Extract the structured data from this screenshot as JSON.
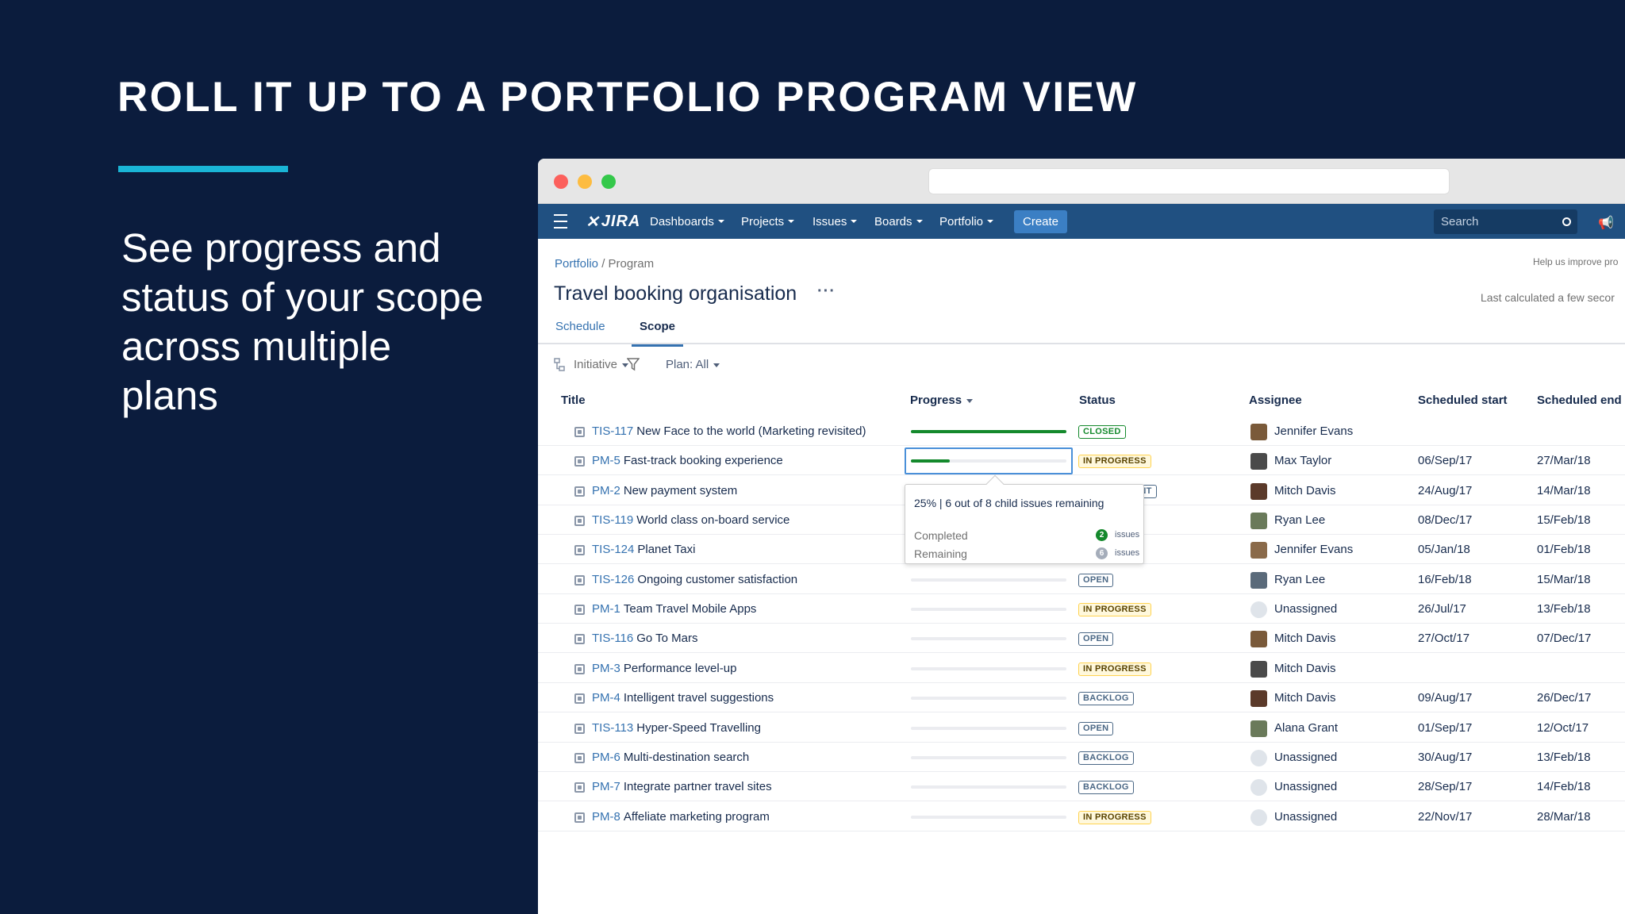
{
  "slide": {
    "title": "ROLL IT UP TO A PORTFOLIO PROGRAM VIEW",
    "body": "See progress and status of your scope across multiple plans"
  },
  "nav": {
    "logo": "JIRA",
    "items": [
      "Dashboards",
      "Projects",
      "Issues",
      "Boards",
      "Portfolio"
    ],
    "create": "Create",
    "search_placeholder": "Search"
  },
  "page": {
    "breadcrumb_root": "Portfolio",
    "breadcrumb_sep": " / ",
    "breadcrumb_current": "Program",
    "help": "Help us improve pro",
    "title": "Travel booking organisation",
    "more": "···",
    "last_calculated": "Last calculated a few secor",
    "tabs": [
      "Schedule",
      "Scope"
    ]
  },
  "filters": {
    "initiative": "Initiative",
    "plan": "Plan: All"
  },
  "columns": [
    "Title",
    "Progress",
    "Status",
    "Assignee",
    "Scheduled start",
    "Scheduled end"
  ],
  "rows": [
    {
      "key": "TIS-117",
      "title": "New Face to the world (Marketing revisited)",
      "progress": 1.0,
      "status": "CLOSED",
      "status_kind": "green",
      "assignee": "Jennifer Evans",
      "start": "",
      "end": ""
    },
    {
      "key": "PM-5",
      "title": "Fast-track booking experience",
      "progress": 0.25,
      "status": "IN PROGRESS",
      "status_kind": "yellow",
      "assignee": "Max Taylor",
      "start": "06/Sep/17",
      "end": "27/Mar/18"
    },
    {
      "key": "PM-2",
      "title": "New payment system",
      "progress": 0,
      "status": "READY FOR DEVELOPMENT",
      "status_kind": "blue",
      "assignee": "Mitch Davis",
      "start": "24/Aug/17",
      "end": "14/Mar/18"
    },
    {
      "key": "TIS-119",
      "title": "World class on-board service",
      "progress": 0,
      "status": "",
      "status_kind": "",
      "assignee": "Ryan Lee",
      "start": "08/Dec/17",
      "end": "15/Feb/18"
    },
    {
      "key": "TIS-124",
      "title": "Planet Taxi",
      "progress": 0,
      "status": "",
      "status_kind": "",
      "assignee": "Jennifer Evans",
      "start": "05/Jan/18",
      "end": "01/Feb/18"
    },
    {
      "key": "TIS-126",
      "title": "Ongoing customer satisfaction",
      "progress": 0,
      "status": "OPEN",
      "status_kind": "blue",
      "assignee": "Ryan Lee",
      "start": "16/Feb/18",
      "end": "15/Mar/18"
    },
    {
      "key": "PM-1",
      "title": "Team Travel Mobile Apps",
      "progress": 0,
      "status": "IN PROGRESS",
      "status_kind": "yellow",
      "assignee": "Unassigned",
      "start": "26/Jul/17",
      "end": "13/Feb/18"
    },
    {
      "key": "TIS-116",
      "title": "Go To Mars",
      "progress": 0,
      "status": "OPEN",
      "status_kind": "blue",
      "assignee": "Mitch Davis",
      "start": "27/Oct/17",
      "end": "07/Dec/17"
    },
    {
      "key": "PM-3",
      "title": "Performance level-up",
      "progress": 0,
      "status": "IN PROGRESS",
      "status_kind": "yellow",
      "assignee": "Mitch Davis",
      "start": "",
      "end": ""
    },
    {
      "key": "PM-4",
      "title": "Intelligent travel suggestions",
      "progress": 0,
      "status": "BACKLOG",
      "status_kind": "blue",
      "assignee": "Mitch Davis",
      "start": "09/Aug/17",
      "end": "26/Dec/17"
    },
    {
      "key": "TIS-113",
      "title": "Hyper-Speed Travelling",
      "progress": 0,
      "status": "OPEN",
      "status_kind": "blue",
      "assignee": "Alana Grant",
      "start": "01/Sep/17",
      "end": "12/Oct/17"
    },
    {
      "key": "PM-6",
      "title": "Multi-destination search",
      "progress": 0,
      "status": "BACKLOG",
      "status_kind": "blue",
      "assignee": "Unassigned",
      "start": "30/Aug/17",
      "end": "13/Feb/18"
    },
    {
      "key": "PM-7",
      "title": "Integrate partner travel sites",
      "progress": 0,
      "status": "BACKLOG",
      "status_kind": "blue",
      "assignee": "Unassigned",
      "start": "28/Sep/17",
      "end": "14/Feb/18"
    },
    {
      "key": "PM-8",
      "title": "Affeliate marketing program",
      "progress": 0,
      "status": "IN PROGRESS",
      "status_kind": "yellow",
      "assignee": "Unassigned",
      "start": "22/Nov/17",
      "end": "28/Mar/18"
    }
  ],
  "tooltip": {
    "header": "25% | 6 out of 8 child issues remaining",
    "completed_label": "Completed",
    "completed_count": "2",
    "remaining_label": "Remaining",
    "remaining_count": "6",
    "unit": "issues"
  },
  "colors": {
    "slide_bg": "#0b1c3d",
    "accent_rule": "#1ab5d6",
    "navbar": "#205081",
    "link": "#3572b0",
    "progress_fill": "#14892c"
  }
}
